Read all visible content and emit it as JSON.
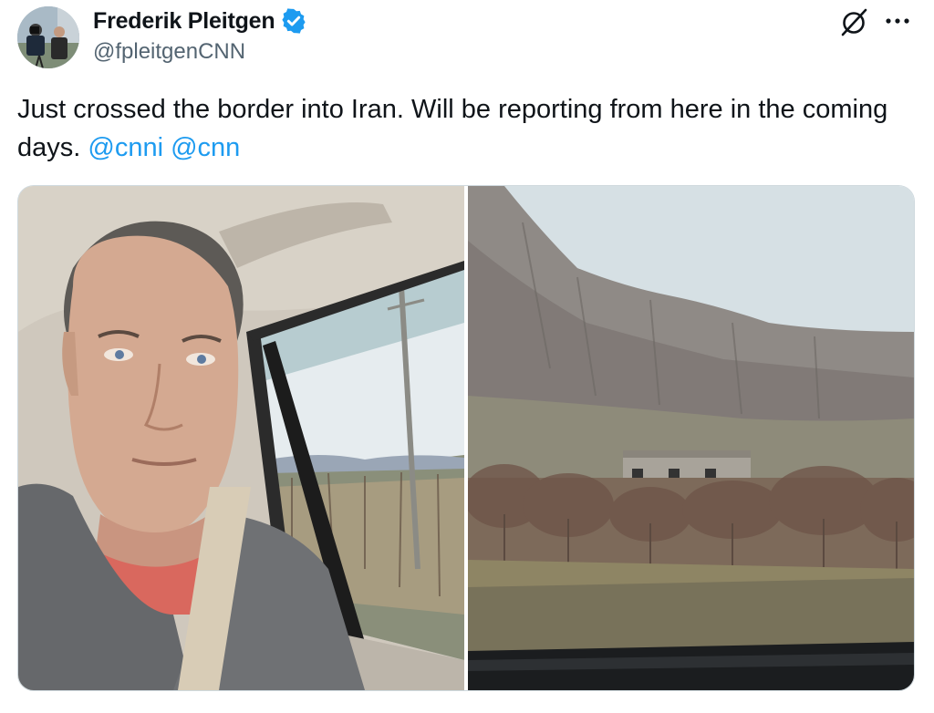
{
  "author": {
    "name": "Frederik Pleitgen",
    "handle": "@fpleitgenCNN"
  },
  "tweet": {
    "text_main": "Just crossed the border into Iran. Will be reporting from here in the coming days.",
    "mention_1": "@cnni",
    "mention_2": "@cnn"
  },
  "icons": {
    "verified": "verified-badge-icon",
    "grok": "grok-icon",
    "more": "more-options-icon"
  },
  "colors": {
    "accent": "#1d9bf0",
    "text_primary": "#0f1419",
    "text_secondary": "#536471",
    "border": "#cfd9de"
  }
}
